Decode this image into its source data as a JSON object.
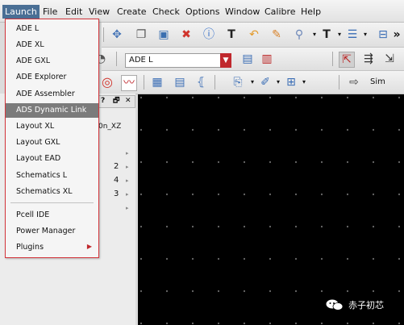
{
  "menubar": {
    "items": [
      "Launch",
      "File",
      "Edit",
      "View",
      "Create",
      "Check",
      "Options",
      "Window",
      "Calibre",
      "Help"
    ]
  },
  "launch_menu": {
    "items": [
      "ADE L",
      "ADE XL",
      "ADE GXL",
      "ADE Explorer",
      "ADE Assembler",
      "ADS Dynamic Link",
      "Layout XL",
      "Layout GXL",
      "Layout EAD",
      "Schematics L",
      "Schematics XL",
      "Pcell IDE",
      "Power Manager",
      "Plugins"
    ],
    "highlighted": "ADS Dynamic Link"
  },
  "toolbar": {
    "ade_combo_value": "ADE L",
    "more_label": "»",
    "sim_label": "Sim"
  },
  "panel": {
    "header_buttons": [
      "?",
      "🗗",
      "✕"
    ],
    "column_label": "0n_XZ",
    "row_numbers": [
      "2",
      "4",
      "3"
    ]
  },
  "watermark": {
    "text": "赤子初芯"
  },
  "colors": {
    "menu_highlight": "#7b7b7b",
    "menu_border": "#d3353b",
    "canvas": "#000000",
    "menubar_active": "#4a6f95"
  }
}
